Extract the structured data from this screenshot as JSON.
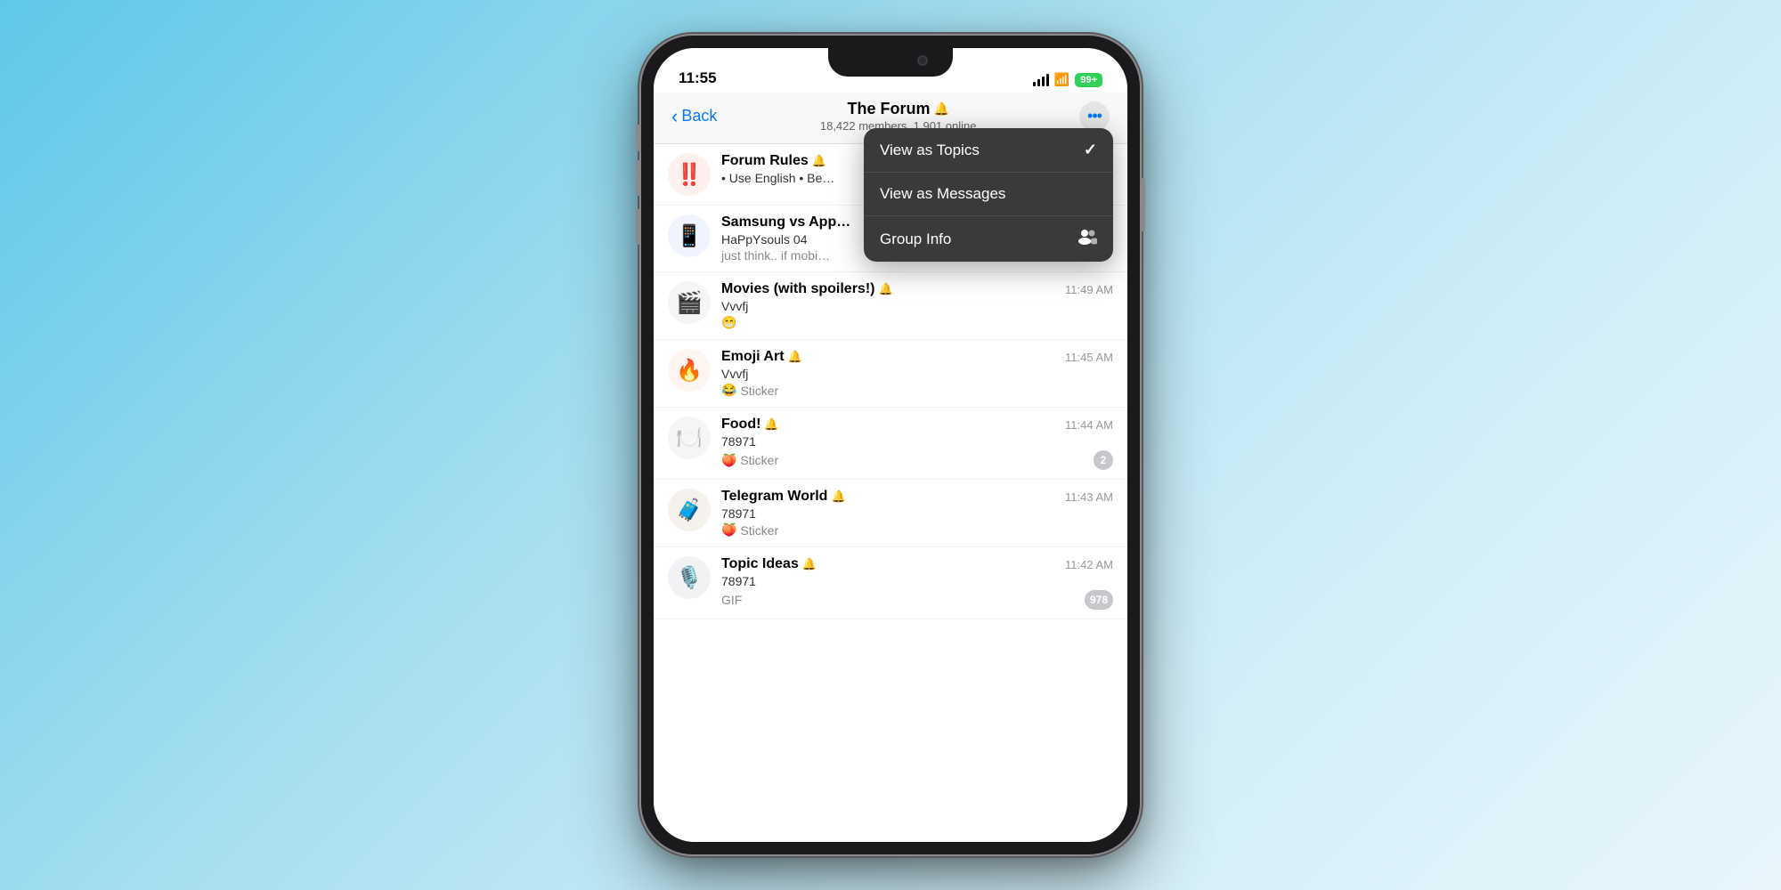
{
  "background": {
    "gradient_start": "#5fc8e8",
    "gradient_end": "#e8f5fb"
  },
  "status_bar": {
    "time": "11:55",
    "battery_label": "99+",
    "battery_color": "#30d158"
  },
  "nav": {
    "back_label": "Back",
    "title": "The Forum",
    "subtitle": "18,422 members, 1,901 online",
    "muted_icon": "🔔"
  },
  "dropdown_menu": {
    "items": [
      {
        "label": "View as Topics",
        "icon": "✓",
        "icon_type": "check"
      },
      {
        "label": "View as Messages",
        "icon": "",
        "icon_type": "none"
      },
      {
        "label": "Group Info",
        "icon": "👥",
        "icon_type": "people"
      }
    ]
  },
  "topics": [
    {
      "icon": "‼️",
      "icon_bg": "red-exclaim",
      "name": "Forum Rules",
      "muted": true,
      "time": "",
      "sender": "• Use English • Be…",
      "preview": "",
      "preview_emoji": "",
      "badge": ""
    },
    {
      "icon": "📱",
      "icon_bg": "phone-emoji",
      "name": "Samsung vs App…",
      "muted": false,
      "time": "",
      "sender": "HaPpYsouls 04",
      "preview": "just think.. if mobi…",
      "preview_emoji": "",
      "badge": ""
    },
    {
      "icon": "🎬",
      "icon_bg": "clapboard",
      "name": "Movies (with spoilers!)",
      "muted": true,
      "time": "11:49 AM",
      "sender": "Vvvfj",
      "preview": "😁",
      "preview_emoji": "😁",
      "badge": ""
    },
    {
      "icon": "🔥",
      "icon_bg": "fire",
      "name": "Emoji Art",
      "muted": true,
      "time": "11:45 AM",
      "sender": "Vvvfj",
      "preview": "😂 Sticker",
      "preview_emoji": "😂",
      "badge": ""
    },
    {
      "icon": "🍽️",
      "icon_bg": "food",
      "name": "Food!",
      "muted": true,
      "time": "11:44 AM",
      "sender": "78971",
      "preview": "🍑 Sticker",
      "preview_emoji": "🍑",
      "badge": "2"
    },
    {
      "icon": "🧳",
      "icon_bg": "suitcase",
      "name": "Telegram World",
      "muted": true,
      "time": "11:43 AM",
      "sender": "78971",
      "preview": "🍑 Sticker",
      "preview_emoji": "🍑",
      "badge": ""
    },
    {
      "icon": "🎙️",
      "icon_bg": "microphone",
      "name": "Topic Ideas",
      "muted": true,
      "time": "11:42 AM",
      "sender": "78971",
      "preview": "GIF",
      "preview_emoji": "",
      "badge": "978"
    }
  ]
}
